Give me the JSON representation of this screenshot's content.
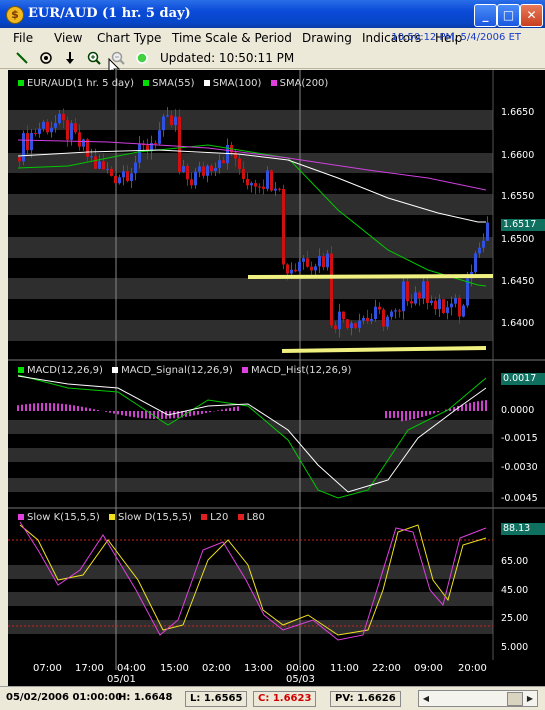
{
  "window": {
    "title": "EUR/AUD (1 hr. 5 day)",
    "icon": "dollar-coin-icon",
    "minimize": "_",
    "maximize": "□",
    "close": "✕"
  },
  "menu": {
    "items": [
      "File",
      "View",
      "Chart Type",
      "Time Scale & Period",
      "Drawing",
      "Indicators",
      "Help"
    ],
    "datetime": "10:50:12 PM, 5/4/2006 ET"
  },
  "toolbar": {
    "tools": [
      "draw-line-icon",
      "crosshair-icon",
      "download-arrow-icon",
      "zoom-in-icon",
      "zoom-out-icon",
      "status-dot-icon"
    ],
    "updated": "Updated: 10:50:11 PM"
  },
  "price_panel": {
    "legend": [
      {
        "label": "EUR/AUD(1 hr. 5 day)",
        "color": "#00e000"
      },
      {
        "label": "SMA(55)",
        "color": "#00e000"
      },
      {
        "label": "SMA(100)",
        "color": "#ffffff"
      },
      {
        "label": "SMA(200)",
        "color": "#e040e0"
      }
    ],
    "y_ticks": [
      "1.6650",
      "1.6600",
      "1.6550",
      "1.6500",
      "1.6450",
      "1.6400"
    ],
    "current": "1.6517"
  },
  "macd_panel": {
    "legend": [
      {
        "label": "MACD(12,26,9)",
        "color": "#00e000"
      },
      {
        "label": "MACD_Signal(12,26,9)",
        "color": "#ffffff"
      },
      {
        "label": "MACD_Hist(12,26,9)",
        "color": "#e040e0"
      }
    ],
    "y_ticks": [
      "0.0000",
      "-0.0015",
      "-0.0030",
      "-0.0045"
    ],
    "current": "0.0017"
  },
  "stoch_panel": {
    "legend": [
      {
        "label": "Slow K(15,5,5)",
        "color": "#e040e0"
      },
      {
        "label": "Slow D(15,5,5)",
        "color": "#f0e020"
      },
      {
        "label": "L20",
        "color": "#e02020"
      },
      {
        "label": "L80",
        "color": "#e02020"
      }
    ],
    "y_ticks": [
      "65.00",
      "45.00",
      "25.00",
      "5.000"
    ],
    "current": "88.13"
  },
  "x_axis": {
    "times": [
      "07:00",
      "17:00",
      "04:00",
      "15:00",
      "02:00",
      "13:00",
      "00:00",
      "11:00",
      "22:00",
      "09:00",
      "20:00"
    ],
    "dates": [
      "05/01",
      "05/03"
    ]
  },
  "status": {
    "datetime": "05/02/2006 01:00:00",
    "high": "H: 1.6648",
    "low": "L: 1.6565",
    "close": "C: 1.6623",
    "pv": "PV: 1.6626"
  },
  "colors": {
    "sma55": "#00c800",
    "sma100": "#ffffff",
    "sma200": "#d040e0",
    "bull": "#3050e0",
    "bear": "#d01010",
    "support": "#f0f080",
    "tag_bg": "#107060"
  }
}
